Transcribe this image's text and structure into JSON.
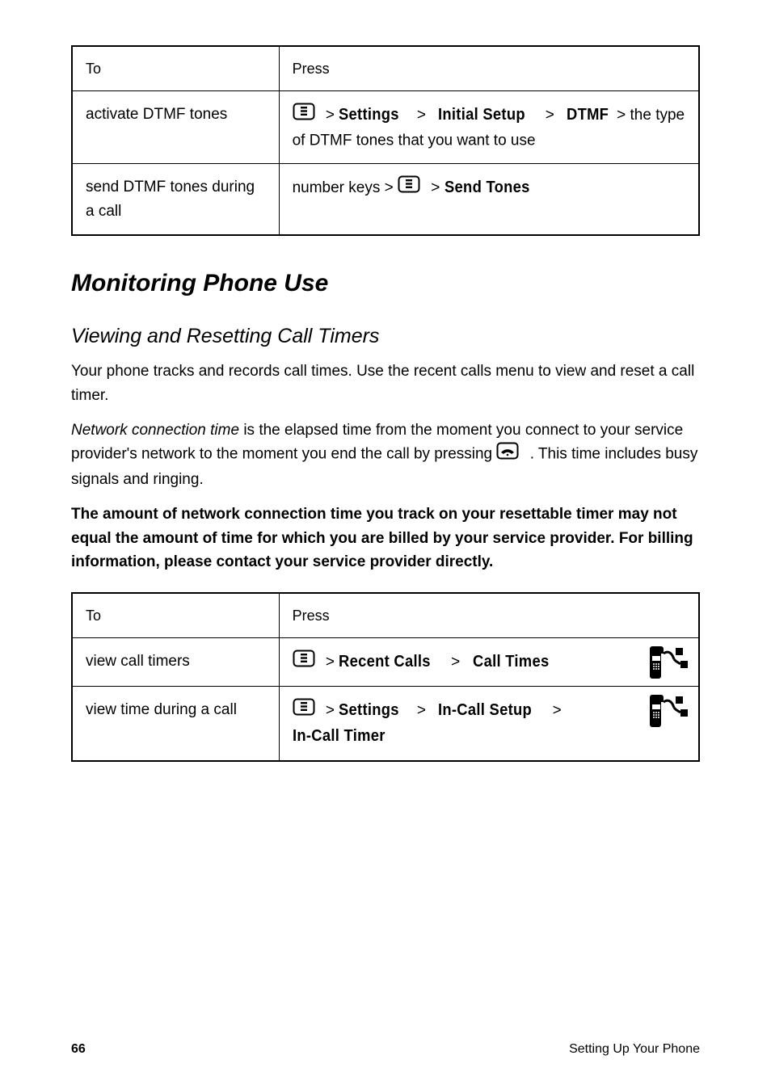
{
  "table1": {
    "header_left": "To",
    "header_right": "Press",
    "row_dtmf": {
      "left": "activate DTMF tones",
      "right_prefix": "",
      "right_path": [
        "Settings",
        "Initial Setup",
        "DTMF"
      ],
      "right_suffix": "",
      "trailing": " > the type of DTMF tones that you want to use"
    },
    "row_send": {
      "left": "send DTMF tones during a call",
      "right_prefix": "number keys > ",
      "right_path": [
        "Send Tones"
      ]
    }
  },
  "monitoring": {
    "heading": "Monitoring Phone Use",
    "sub_heading": "Viewing and Resetting Call Timers",
    "body": "Your phone tracks and records call times. Use the recent calls menu to view and reset a call timer.",
    "line_approx_pre": "Network connection time",
    "line_approx": " is the elapsed time from the moment you connect to your service provider's network to the moment you end the call by pressing ",
    "line_approx_post": ". This time includes busy signals and ringing.",
    "note_label": "The amount of network connection time you track on your resettable timer may not equal the amount of time for which you are billed by your service provider. For billing information, please contact your service provider directly."
  },
  "table2": {
    "header_left": "To",
    "header_right": "Press",
    "row1": {
      "left": "view call timers",
      "right_path": [
        "Recent Calls",
        "Call Times"
      ]
    },
    "row2": {
      "left": "view time during a call",
      "right_path": [
        "Settings",
        "In-Call Setup",
        "In-Call Timer"
      ]
    }
  },
  "footer": {
    "left": "66",
    "right": "Setting Up Your Phone"
  },
  "sep": " > "
}
